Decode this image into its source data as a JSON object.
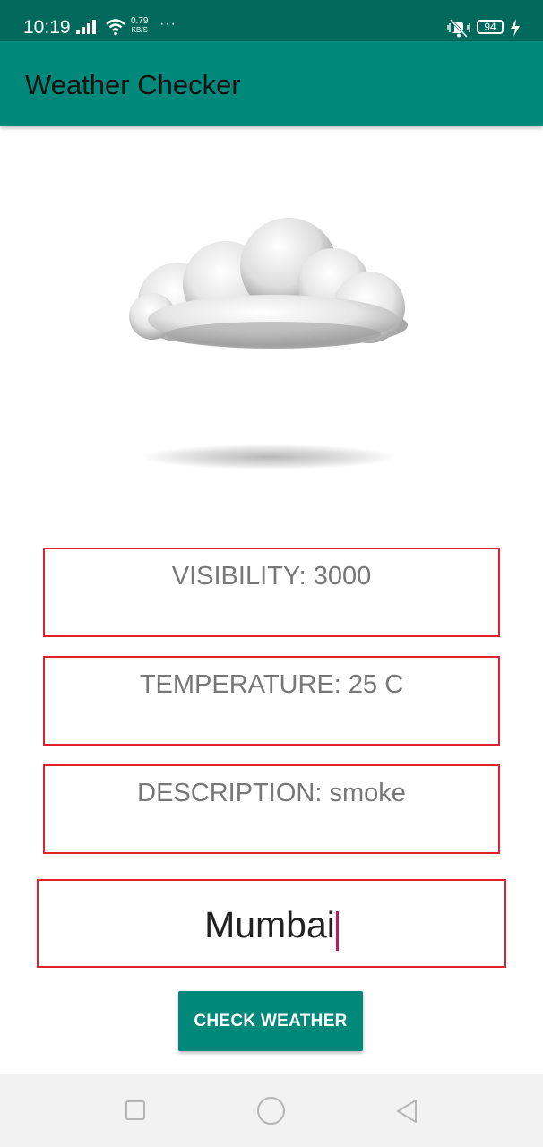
{
  "status_bar": {
    "time": "10:19",
    "net_speed_value": "0.79",
    "net_speed_unit": "KB/S",
    "more": "···",
    "battery": "94",
    "icons": [
      "signal-icon",
      "wifi-icon",
      "mute-icon",
      "battery-icon",
      "charging-icon"
    ]
  },
  "app_bar": {
    "title": "Weather Checker"
  },
  "weather": {
    "image": "cloud-icon",
    "visibility_text": "VISIBILITY: 3000",
    "temperature_text": "TEMPERATURE: 25 C",
    "description_text": "DESCRIPTION: smoke"
  },
  "city_input": {
    "value": "Mumbai"
  },
  "check_button": {
    "label": "CHECK WEATHER"
  },
  "colors": {
    "status_bar": "#00695c",
    "app_bar": "#00897b",
    "box_border": "#e0202a",
    "cursor": "#c2185b",
    "button": "#00897b"
  },
  "nav_bar": {
    "icons": [
      "recent-apps-icon",
      "home-icon",
      "back-icon"
    ]
  }
}
